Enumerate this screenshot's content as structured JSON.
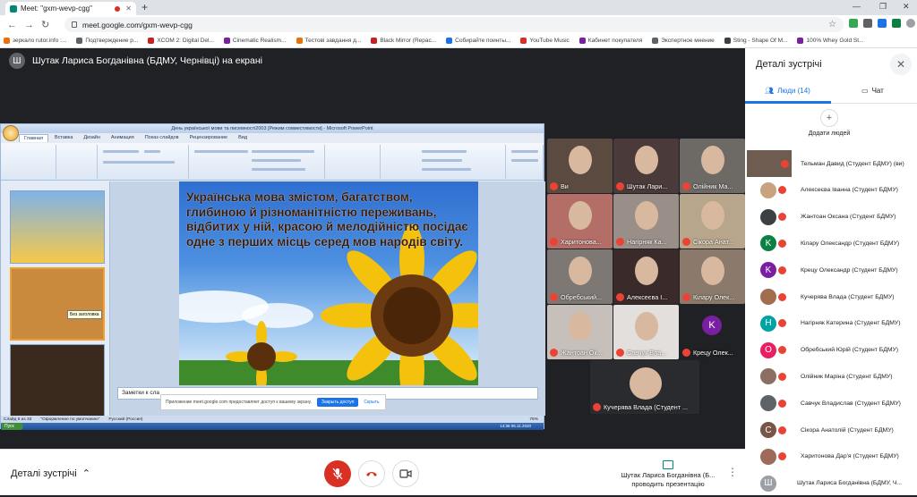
{
  "browser": {
    "tab_title": "Meet: \"gxm-wevp-cgg\"",
    "url": "meet.google.com/gxm-wevp-cgg",
    "bookmarks": [
      {
        "label": "зеркало rutor.info :...",
        "color": "#e8710a"
      },
      {
        "label": "Подтверждение р...",
        "color": "#5f6368"
      },
      {
        "label": "XCOM 2: Digital Del...",
        "color": "#c5221f"
      },
      {
        "label": "Cinematic Realism...",
        "color": "#7b1fa2"
      },
      {
        "label": "Тестові завдання д...",
        "color": "#e8710a"
      },
      {
        "label": "Black Mirror (Repac...",
        "color": "#c5221f"
      },
      {
        "label": "Собирайте поинты...",
        "color": "#1a73e8"
      },
      {
        "label": "YouTube Music",
        "color": "#d93025"
      },
      {
        "label": "Кабинет покупателя",
        "color": "#7b1fa2"
      },
      {
        "label": "Экспертное мнение",
        "color": "#5f6368"
      },
      {
        "label": "Sting - Shape Of M...",
        "color": "#3c4043"
      },
      {
        "label": "100% Whey Gold St...",
        "color": "#7b1fa2"
      }
    ]
  },
  "meet": {
    "presenter_banner": "Шутак Лариса Богданівна (БДМУ, Чернівці) на екрані",
    "presenter_avatar": "Ш"
  },
  "shared_screen": {
    "ppt_title": "День української мови та писемності2003 [Режим совместимости] - Microsoft PowerPoint",
    "ribbon_tabs": [
      "Главная",
      "Вставка",
      "Дизайн",
      "Анимация",
      "Показ слайдов",
      "Рецензирование",
      "Вид"
    ],
    "slide_text": "Українська мова змістом, багатством, глибиною й різноманітністю переживань, відбитих у ній, красою й мелодійністю посідає одне з перших місць серед мов народів світу.",
    "notes_label": "Заметки к сла",
    "share_notice": "Приложение meet.google.com предоставляет доступ к вашему экрану.",
    "share_stop": "Закрыть доступ",
    "share_hide": "Скрыть",
    "status_slide": "Слайд 6 из 33",
    "status_theme": "\"Оформление по умолчанию\"",
    "status_lang": "Русский (Россия)",
    "zoom": "76%",
    "clock_time": "14:36",
    "clock_date": "05.11.2020",
    "thumb_tooltip": "Без заголовка"
  },
  "tiles": [
    {
      "name": "Ви",
      "bg": "#5a4a3f"
    },
    {
      "name": "Шутак Лари...",
      "bg": "#4a3a3a"
    },
    {
      "name": "Олійник Ма...",
      "bg": "#6d6a66"
    },
    {
      "name": "Харитонова...",
      "bg": "#b46e68"
    },
    {
      "name": "Нагірняк Ка...",
      "bg": "#9a8e88"
    },
    {
      "name": "Сікора Анат...",
      "bg": "#b7a58c"
    },
    {
      "name": "Обребський...",
      "bg": "#7d7873"
    },
    {
      "name": "Алексеєва І...",
      "bg": "#3a2a2a"
    },
    {
      "name": "Кілару Олек...",
      "bg": "#8b7a6b"
    },
    {
      "name": "Жантоан Ок...",
      "bg": "#c7c0ba"
    },
    {
      "name": "Савчук Вла...",
      "bg": "#e3dfdc"
    },
    {
      "name": "Крецу Олек...",
      "bg": "#202124",
      "letter": "K"
    },
    {
      "name": "Кучерява Влада (Студент ...",
      "bg": "#2a2b2e"
    }
  ],
  "controls": {
    "details_label": "Деталі зустрічі",
    "presenter_name": "Шутак Лариса Богданівна (Б...",
    "presenting_label": "проводить презентацію"
  },
  "panel": {
    "title": "Деталі зустрічі",
    "people_tab": "Люди (14)",
    "chat_tab": "Чат",
    "add_people": "Додати людей",
    "participants": [
      {
        "name": "Тельман Давид (Студент БДМУ) (ви)",
        "color": "#6d5c4f",
        "letter": ""
      },
      {
        "name": "Алексеєва Іванна (Студент БДМУ)",
        "color": "#c9a27f",
        "letter": ""
      },
      {
        "name": "Жантоан Оксана (Студент БДМУ)",
        "color": "#3c4043",
        "letter": ""
      },
      {
        "name": "Кілару Олександр (Студент БДМУ)",
        "color": "#0b8043",
        "letter": "K"
      },
      {
        "name": "Крецу Олександр (Студент БДМУ)",
        "color": "#7b1fa2",
        "letter": "K"
      },
      {
        "name": "Кучерява Влада (Студент БДМУ)",
        "color": "#a26d4f",
        "letter": ""
      },
      {
        "name": "Нагірняк Катерина (Студент БДМУ)",
        "color": "#00a3a3",
        "letter": "H"
      },
      {
        "name": "Обребський Юрій (Студент БДМУ)",
        "color": "#e91e63",
        "letter": "O"
      },
      {
        "name": "Олійник Маріна (Студент БДМУ)",
        "color": "#8d6e63",
        "letter": ""
      },
      {
        "name": "Савчук Владислав (Студент БДМУ)",
        "color": "#5f6368",
        "letter": ""
      },
      {
        "name": "Сікора Анатолій (Студент БДМУ)",
        "color": "#795548",
        "letter": "C"
      },
      {
        "name": "Харитонова Дар'я (Студент БДМУ)",
        "color": "#9e6a5a",
        "letter": ""
      },
      {
        "name": "Шутак Лариса Богданівна (БДМУ, Ч...",
        "color": "#9aa0a6",
        "letter": "Ш"
      }
    ]
  }
}
